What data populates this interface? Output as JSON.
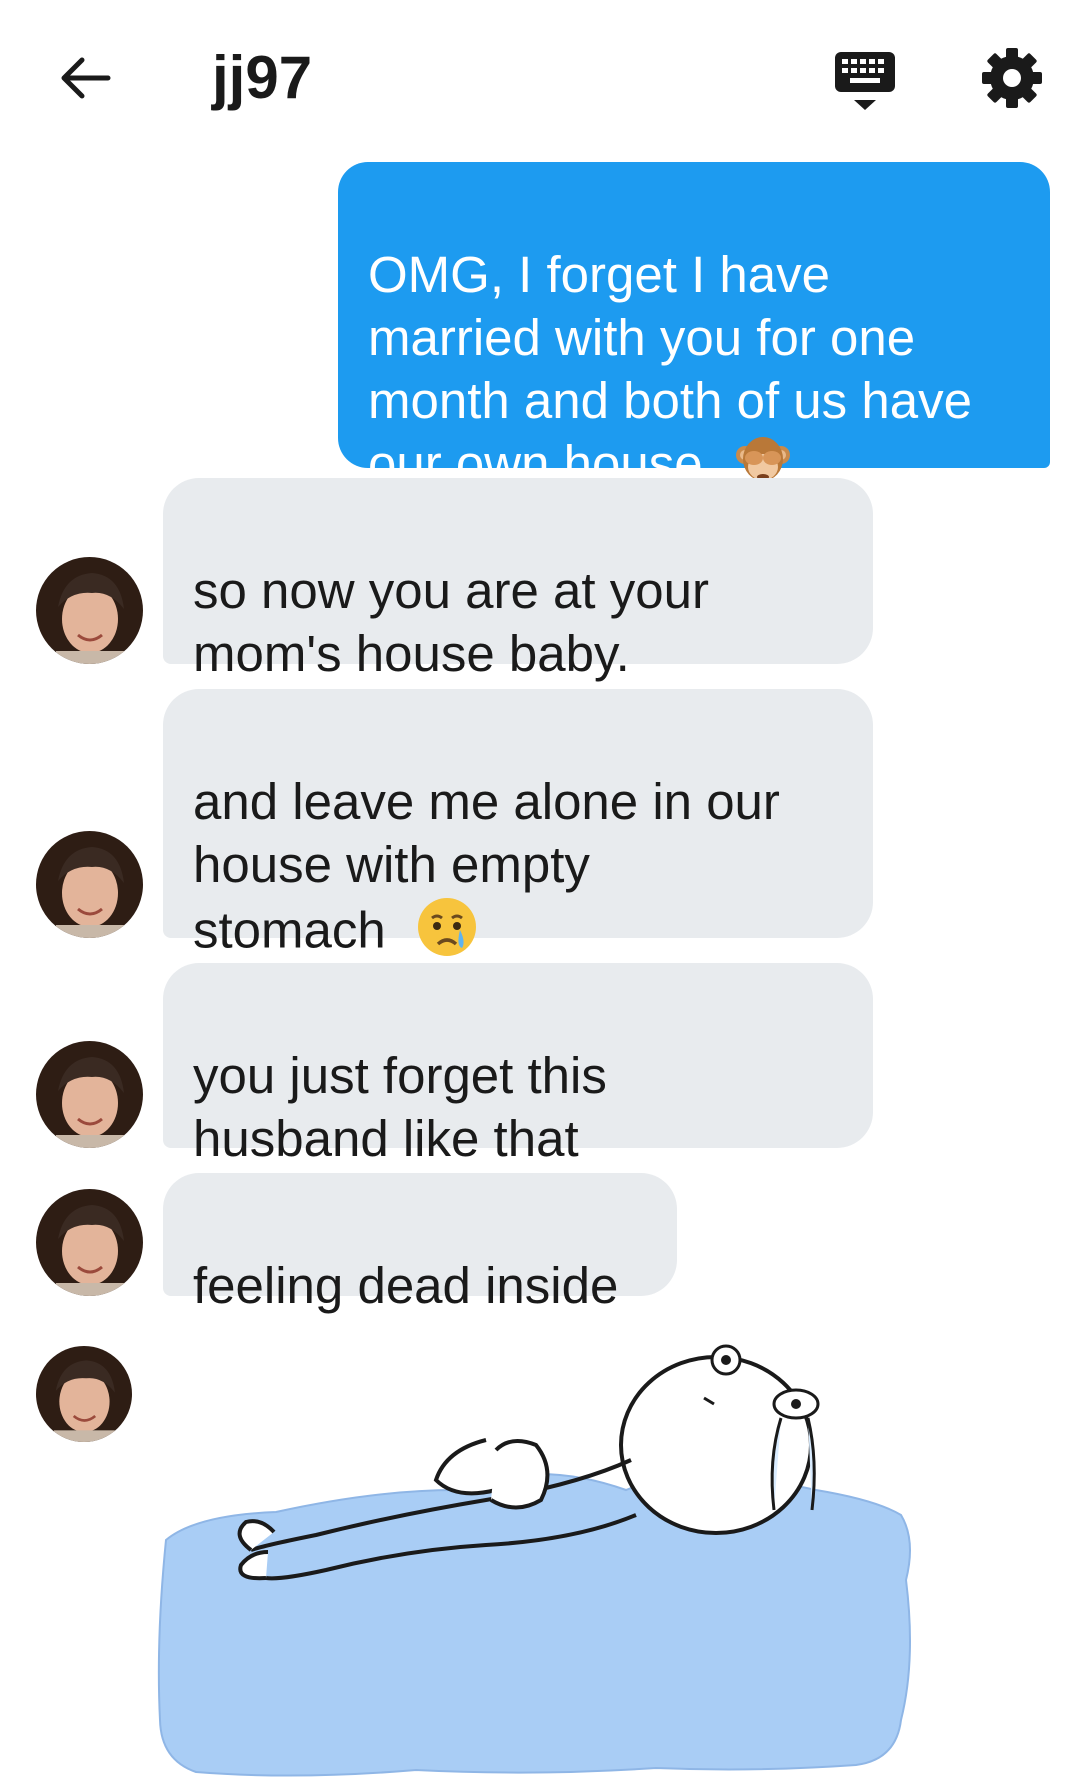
{
  "header": {
    "title": "jj97",
    "icons": {
      "back": "arrow-left-icon",
      "keyboard": "keyboard-icon",
      "settings": "gear-icon"
    }
  },
  "messages": [
    {
      "direction": "outgoing",
      "text": "OMG, I forget I have\nmarried with you for one\nmonth and both of us have\nour own house.",
      "emoji": "see-no-evil-monkey-emoji"
    },
    {
      "direction": "incoming",
      "text": "so now you are at your\nmom's house baby."
    },
    {
      "direction": "incoming",
      "text": "and leave me alone in our\nhouse with empty\nstomach",
      "emoji": "crying-face-emoji"
    },
    {
      "direction": "incoming",
      "text": "you just forget this\nhusband like that"
    },
    {
      "direction": "incoming",
      "text": "feeling dead inside"
    },
    {
      "direction": "incoming",
      "type": "sticker",
      "sticker": "crying-puddle-sticker"
    }
  ],
  "colors": {
    "outgoing_bubble": "#1d9bf0",
    "incoming_bubble": "#e8ebee",
    "sticker_puddle": "#a9cdf5"
  }
}
